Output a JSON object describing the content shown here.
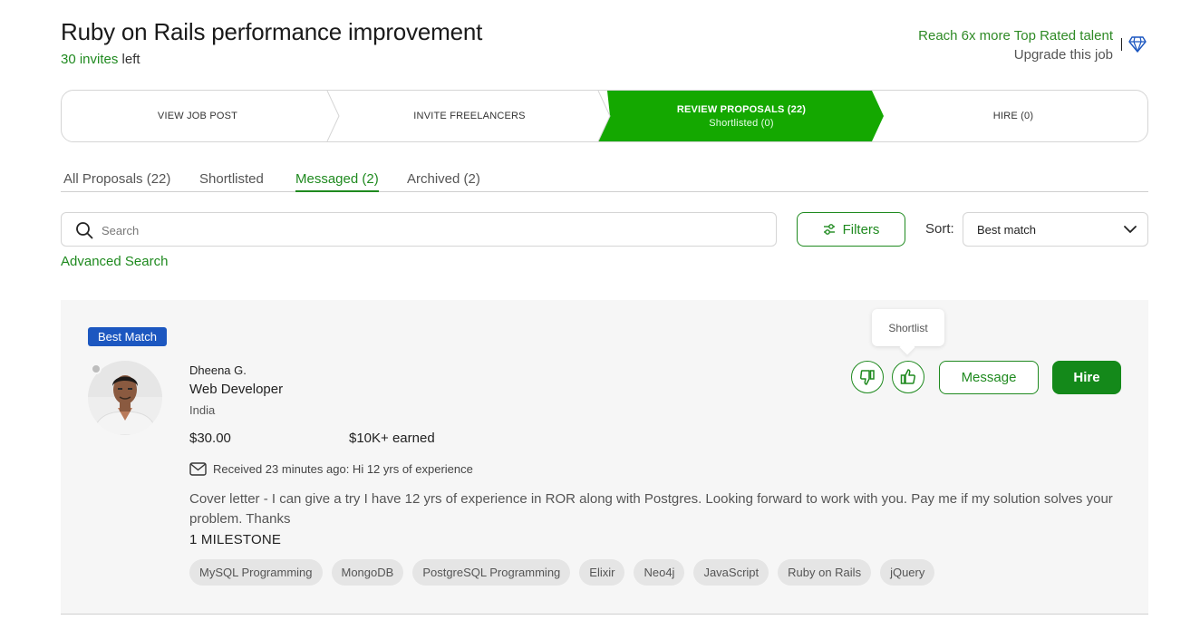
{
  "header": {
    "title": "Ruby on Rails performance improvement",
    "invites_count": "30 invites",
    "invites_suffix": " left",
    "upsell_reach": "Reach 6x more Top Rated talent",
    "upsell_upgrade": "Upgrade this job"
  },
  "stepper": {
    "steps": [
      {
        "label": "VIEW JOB POST"
      },
      {
        "label": "INVITE FREELANCERS"
      },
      {
        "label": "REVIEW PROPOSALS (22)",
        "sub": "Shortlisted (0)"
      },
      {
        "label": "HIRE (0)"
      }
    ],
    "active_index": 2,
    "active_color": "#14a800"
  },
  "tabs": [
    {
      "label": "All Proposals (22)"
    },
    {
      "label": "Shortlisted"
    },
    {
      "label": "Messaged (2)"
    },
    {
      "label": "Archived (2)"
    }
  ],
  "active_tab": 2,
  "search": {
    "placeholder": "Search",
    "advanced_label": "Advanced Search"
  },
  "filters_label": "Filters",
  "sort": {
    "label": "Sort:",
    "value": "Best match"
  },
  "proposal": {
    "badge": "Best Match",
    "name": "Dheena G.",
    "role": "Web Developer",
    "country": "India",
    "rate": "$30.00",
    "earned": "$10K+ earned",
    "received": "Received 23 minutes ago: Hi 12 yrs of experience",
    "cover_letter": "Cover letter - I can give a try I have 12 yrs of experience in ROR along with Postgres. Looking forward to work with you. Pay me if my solution solves your problem. Thanks",
    "milestone": "1 MILESTONE",
    "skills": [
      "MySQL Programming",
      "MongoDB",
      "PostgreSQL Programming",
      "Elixir",
      "Neo4j",
      "JavaScript",
      "Ruby on Rails",
      "jQuery"
    ],
    "tooltip": "Shortlist",
    "message_label": "Message",
    "hire_label": "Hire",
    "icons": {
      "dislike": "thumbs-down-icon",
      "like": "thumbs-up-icon",
      "envelope": "envelope-icon",
      "avatar": "profile-photo"
    }
  },
  "colors": {
    "brand_green": "#14a800",
    "link_green": "#1f8a1f",
    "badge_blue": "#1c57c0"
  }
}
